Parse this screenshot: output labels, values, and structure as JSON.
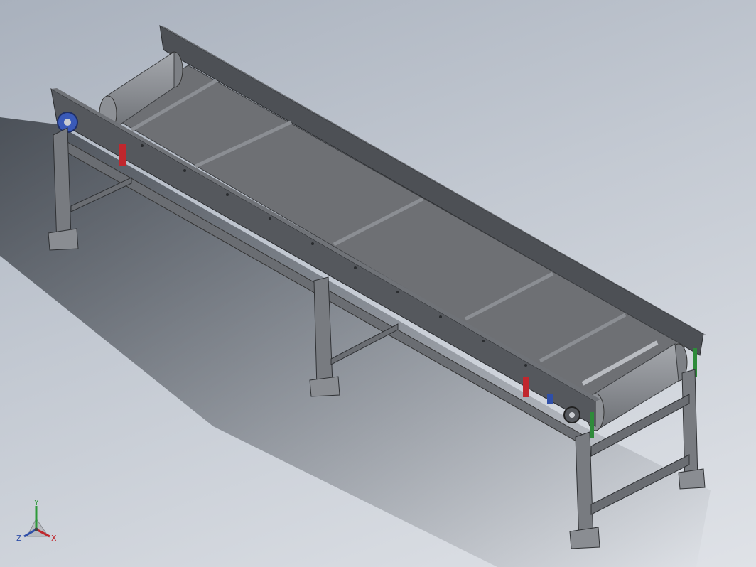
{
  "viewport": {
    "background_top": "#a9b1bd",
    "background_bottom": "#dfe2e7"
  },
  "model": {
    "subject": "belt-conveyor",
    "frame_color": "#5b5e63",
    "belt_color": "#6e7074",
    "roller_color": "#8a8d92",
    "leg_color": "#787b80",
    "accent_red": "#c0272d",
    "accent_blue": "#2f4fa8",
    "accent_green": "#2e8b3a"
  },
  "triad": {
    "y_label": "Y",
    "x_label": "X",
    "z_label": "Z",
    "y_color": "#2e9a3a",
    "x_color": "#c0272d",
    "z_color": "#2f4fa8"
  }
}
